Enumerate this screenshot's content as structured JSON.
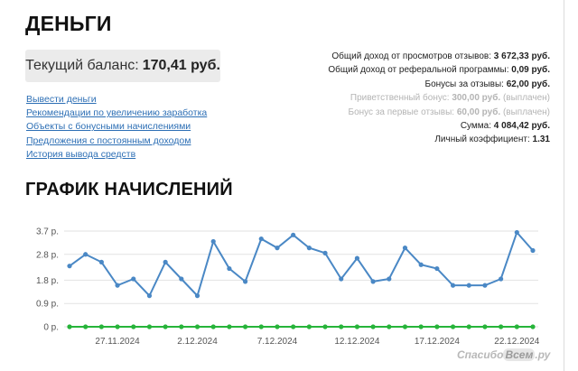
{
  "header": {
    "title": "ДЕНЬГИ"
  },
  "balance": {
    "label": "Текущий баланс:",
    "value": "170,41 руб."
  },
  "links": [
    "Вывести деньги",
    "Рекомендации по увеличению заработка",
    "Объекты с бонусными начислениями",
    "Предложения с постоянным доходом",
    "История вывода средств"
  ],
  "stats": [
    {
      "label": "Общий доход от просмотров отзывов:",
      "value": "3 672,33 руб.",
      "suffix": "",
      "muted": false
    },
    {
      "label": "Общий доход от реферальной программы:",
      "value": "0,09 руб.",
      "suffix": "",
      "muted": false
    },
    {
      "label": "Бонусы за отзывы:",
      "value": "62,00 руб.",
      "suffix": "",
      "muted": false
    },
    {
      "label": "Приветственный бонус:",
      "value": "300,00 руб.",
      "suffix": "(выплачен)",
      "muted": true
    },
    {
      "label": "Бонус за первые отзывы:",
      "value": "60,00 руб.",
      "suffix": "(выплачен)",
      "muted": true
    },
    {
      "label": "Сумма:",
      "value": "4 084,42 руб.",
      "suffix": "",
      "muted": false
    },
    {
      "label": "Личный коэффициент:",
      "value": "1.31",
      "suffix": "",
      "muted": false
    }
  ],
  "chart_title": {
    "bold": "ГРАФИК",
    "rest": "НАЧИСЛЕНИЙ"
  },
  "watermark": {
    "pre": "Спасибо",
    "hl": "Всем",
    "post": ".ру"
  },
  "chart_data": {
    "type": "line",
    "title": "ГРАФИК НАЧИСЛЕНИЙ",
    "xlabel": "",
    "ylabel": "",
    "ylim": [
      0,
      3.7
    ],
    "yticks": [
      0,
      0.9,
      1.8,
      2.8,
      3.7
    ],
    "ytick_labels": [
      "0 р.",
      "0.9 р.",
      "1.8 р.",
      "2.8 р.",
      "3.7 р."
    ],
    "x_tick_labels": [
      "27.11.2024",
      "2.12.2024",
      "7.12.2024",
      "12.12.2024",
      "17.12.2024",
      "22.12.2024"
    ],
    "x_tick_indices": [
      3,
      8,
      13,
      18,
      23,
      28
    ],
    "grid": true,
    "colors": {
      "series1": "#4a88c5",
      "series2": "#27b43a",
      "grid": "#e2e2e2",
      "axis_text": "#555555"
    },
    "series": [
      {
        "name": "",
        "values": [
          2.35,
          2.8,
          2.5,
          1.6,
          1.85,
          1.2,
          2.5,
          1.85,
          1.2,
          3.3,
          2.25,
          1.75,
          3.4,
          3.05,
          3.55,
          3.05,
          2.85,
          1.85,
          2.65,
          1.75,
          1.85,
          3.05,
          2.4,
          2.25,
          1.6,
          1.6,
          1.6,
          1.85,
          3.65,
          2.95
        ]
      },
      {
        "name": "",
        "values": [
          0,
          0,
          0,
          0,
          0,
          0,
          0,
          0,
          0,
          0,
          0,
          0,
          0,
          0,
          0,
          0,
          0,
          0,
          0,
          0,
          0,
          0,
          0,
          0,
          0,
          0,
          0,
          0,
          0,
          0
        ]
      }
    ]
  }
}
